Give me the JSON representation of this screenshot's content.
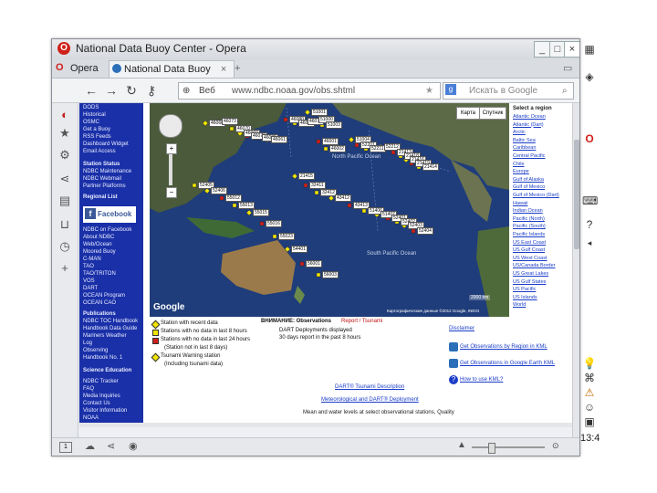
{
  "window": {
    "title": "National Data Buoy Center - Opera",
    "controls": [
      "_",
      "□",
      "×"
    ]
  },
  "tabs": [
    {
      "label": "Opera"
    },
    {
      "label": "National Data Buoy"
    }
  ],
  "address": {
    "prefix": "Веб",
    "url": "www.ndbc.noaa.gov/obs.shtml",
    "search_placeholder": "Искать в Google"
  },
  "leftnav": {
    "top_items": [
      "DODS",
      "Historical",
      "OSMC",
      "Get a Buoy",
      "RSS Feeds",
      "Dashboard Widget",
      "Email Access"
    ],
    "section1_title": "Station Status",
    "section1_items": [
      "NDBC Maintenance",
      "NDBC Webmail",
      "Partner Platforms"
    ],
    "social_title": "Regional List",
    "facebook": "Facebook",
    "after_fb": [
      "NDBC on Facebook",
      "About NDBC",
      "Web/Ocean",
      "Moored Buoy",
      "C-MAN",
      "TAO",
      "TAO/TRITON",
      "VOS",
      "DART",
      "OCEAN Program",
      "OCEAN CAO"
    ],
    "pub_title": "Publications",
    "pub_items": [
      "NDBC TOC Handbook",
      "Handbook Data Guide",
      "Mariners Weather",
      "Log",
      "Observing",
      "Handbook No. 1"
    ],
    "science_title": "Science Education",
    "bottom_items": [
      "NDBC Tracker",
      "FAQ",
      "Media Inquiries",
      "Contact Us",
      "Visitor Information",
      "NOAA"
    ]
  },
  "map_labels": [
    "46066",
    "46073",
    "46070",
    "46060",
    "46078",
    "46035",
    "46061",
    "46080",
    "46072",
    "46075",
    "46001",
    "46002",
    "51001",
    "51000",
    "51003",
    "51004",
    "52201",
    "52211",
    "52212",
    "21413",
    "21418",
    "21416",
    "21419",
    "21414",
    "21415",
    "32411",
    "32412",
    "43412",
    "43413",
    "51406",
    "51407",
    "52401",
    "52402",
    "52403",
    "52404",
    "52405",
    "52406",
    "55012",
    "55013",
    "55015",
    "55016",
    "55023",
    "54401",
    "56001",
    "56003"
  ],
  "map_buttons": {
    "map": "Карта",
    "satellite": "Спутник",
    "google": "Google",
    "copyright": "Картографические данные ©2012 Google, INEGI",
    "ocean1": "North Pacific Ocean",
    "ocean2": "South Pacific Ocean",
    "scale": "2000 km"
  },
  "right_panel": {
    "title": "Select a region",
    "items": [
      "Atlantic Ocean",
      "Atlantic (Dart)",
      "Arctic",
      "Baltic Sea",
      "Caribbean",
      "Central Pacific",
      "Chile",
      "Europe",
      "Gulf of Alaska",
      "Gulf of Mexico",
      "Gulf of Mexico (Dart)",
      "Hawaii",
      "Indian Ocean",
      "Pacific (North)",
      "Pacific (South)",
      "Pacific Islands",
      "US East Coast",
      "US Gulf Coast",
      "US West Coast",
      "US/Canada Border",
      "US Great Lakes",
      "US Gulf States",
      "US Pacific",
      "US Islands",
      "World"
    ]
  },
  "legend": {
    "items": [
      "Station with recent data",
      "Stations with no data in last 8 hours",
      "Stations with no data in last 24 hours",
      "(Station not in last 8 days)",
      "Tsunami Warning station",
      "(Including tsunami data)"
    ],
    "center_title": "ВНИМАНИЕ: Observations",
    "center_note": "Report / Tsunami",
    "center_line1": "DART Deployments displayed",
    "center_line2": "30 days report in the past 8 hours",
    "right_links": [
      "Disclaimer",
      "Get Observations by Region in KML",
      "Get Observations in Google Earth KML",
      "How to use KML?"
    ],
    "footer_links": [
      "DART® Tsunami Description",
      "Meteorological and DART® Deployment",
      "Mean and water levels at select observational stations, Quality"
    ]
  },
  "desktop": {
    "clock": "13:4"
  },
  "colors": {
    "nav_blue": "#1a30a8",
    "ocean": "#1f3d7a",
    "link": "#1a3cc8",
    "marker_yellow": "#f2e600",
    "marker_red": "#d0201a"
  }
}
